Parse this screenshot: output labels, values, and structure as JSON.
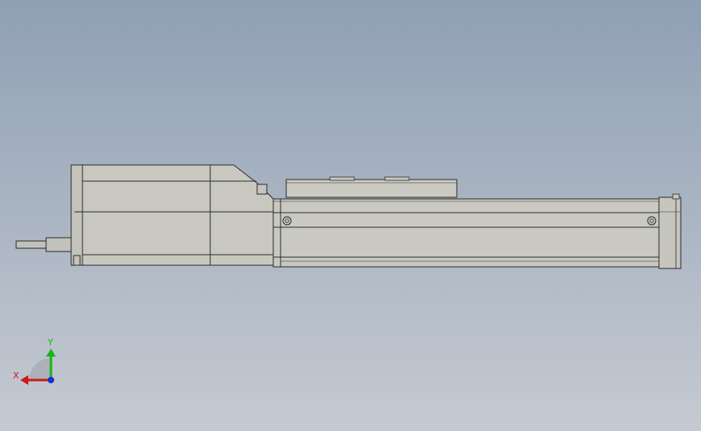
{
  "axis_triad": {
    "x_label": "X",
    "y_label": "Y",
    "x_color": "#d01818",
    "y_color": "#18b418",
    "z_color": "#1830d0"
  },
  "model": {
    "body_color": "#c9c9c0",
    "edge_color": "#2a2a2a",
    "shaft_color": "#bdbdb6"
  },
  "background": {
    "top": "#8fa0b4",
    "bottom": "#c5cad2"
  }
}
